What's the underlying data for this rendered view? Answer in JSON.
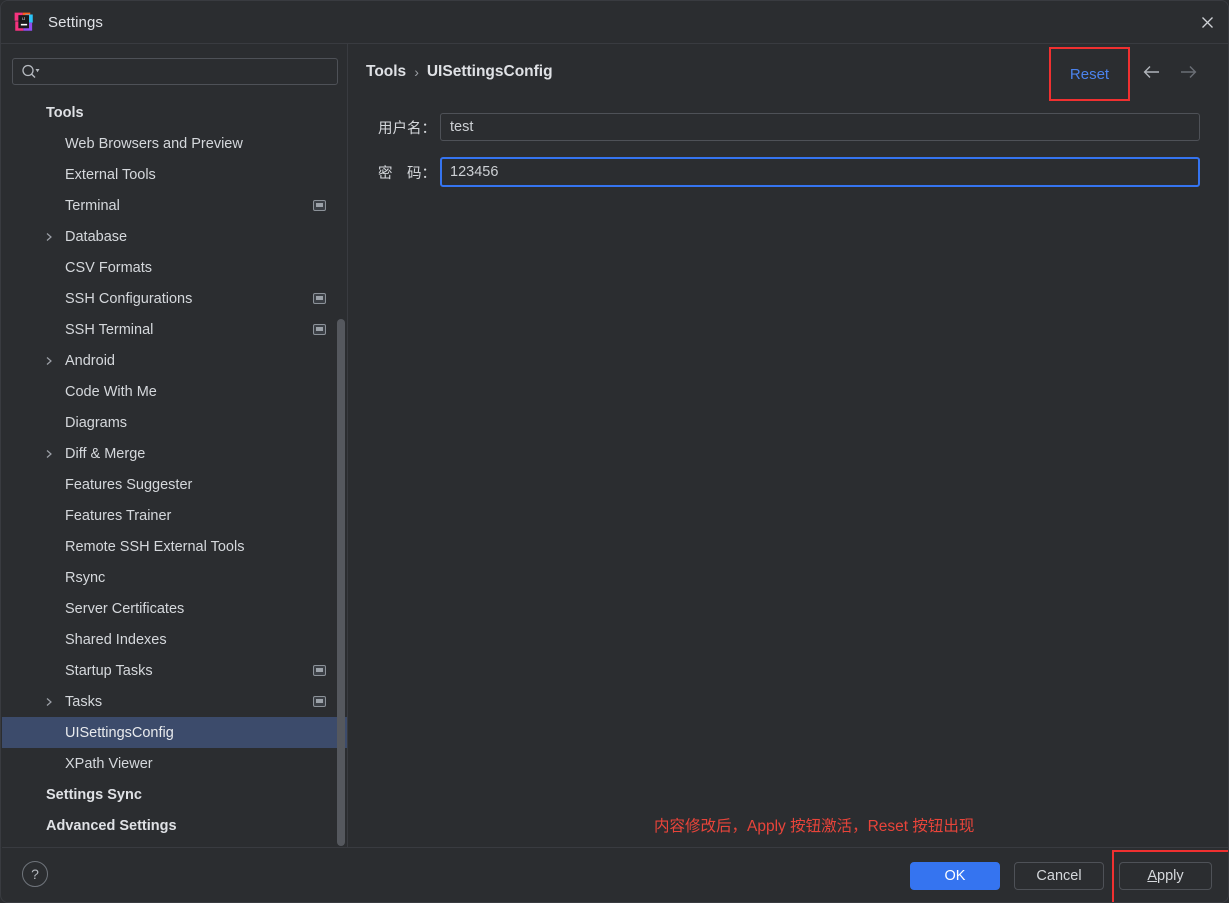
{
  "window": {
    "title": "Settings",
    "logo_icon": "intellij-idea-logo",
    "close_icon": "close-icon"
  },
  "sidebar": {
    "search": {
      "value": "",
      "placeholder": "",
      "icon": "search-icon"
    },
    "items": [
      {
        "label": "Tools",
        "level": 0,
        "arrow": false,
        "badge": false,
        "selected": false
      },
      {
        "label": "Web Browsers and Preview",
        "level": 1,
        "arrow": false,
        "badge": false,
        "selected": false
      },
      {
        "label": "External Tools",
        "level": 1,
        "arrow": false,
        "badge": false,
        "selected": false
      },
      {
        "label": "Terminal",
        "level": 1,
        "arrow": false,
        "badge": true,
        "selected": false
      },
      {
        "label": "Database",
        "level": 1,
        "arrow": true,
        "badge": false,
        "selected": false
      },
      {
        "label": "CSV Formats",
        "level": 1,
        "arrow": false,
        "badge": false,
        "selected": false
      },
      {
        "label": "SSH Configurations",
        "level": 1,
        "arrow": false,
        "badge": true,
        "selected": false
      },
      {
        "label": "SSH Terminal",
        "level": 1,
        "arrow": false,
        "badge": true,
        "selected": false
      },
      {
        "label": "Android",
        "level": 1,
        "arrow": true,
        "badge": false,
        "selected": false
      },
      {
        "label": "Code With Me",
        "level": 1,
        "arrow": false,
        "badge": false,
        "selected": false
      },
      {
        "label": "Diagrams",
        "level": 1,
        "arrow": false,
        "badge": false,
        "selected": false
      },
      {
        "label": "Diff & Merge",
        "level": 1,
        "arrow": true,
        "badge": false,
        "selected": false
      },
      {
        "label": "Features Suggester",
        "level": 1,
        "arrow": false,
        "badge": false,
        "selected": false
      },
      {
        "label": "Features Trainer",
        "level": 1,
        "arrow": false,
        "badge": false,
        "selected": false
      },
      {
        "label": "Remote SSH External Tools",
        "level": 1,
        "arrow": false,
        "badge": false,
        "selected": false
      },
      {
        "label": "Rsync",
        "level": 1,
        "arrow": false,
        "badge": false,
        "selected": false
      },
      {
        "label": "Server Certificates",
        "level": 1,
        "arrow": false,
        "badge": false,
        "selected": false
      },
      {
        "label": "Shared Indexes",
        "level": 1,
        "arrow": false,
        "badge": false,
        "selected": false
      },
      {
        "label": "Startup Tasks",
        "level": 1,
        "arrow": false,
        "badge": true,
        "selected": false
      },
      {
        "label": "Tasks",
        "level": 1,
        "arrow": true,
        "badge": true,
        "selected": false
      },
      {
        "label": "UISettingsConfig",
        "level": 1,
        "arrow": false,
        "badge": false,
        "selected": true
      },
      {
        "label": "XPath Viewer",
        "level": 1,
        "arrow": false,
        "badge": false,
        "selected": false
      },
      {
        "label": "Settings Sync",
        "level": 0,
        "arrow": false,
        "badge": false,
        "selected": false
      },
      {
        "label": "Advanced Settings",
        "level": 0,
        "arrow": false,
        "badge": false,
        "selected": false
      }
    ]
  },
  "content": {
    "breadcrumb": {
      "root": "Tools",
      "separator": "›",
      "current": "UISettingsConfig"
    },
    "reset_label": "Reset",
    "nav_back_icon": "arrow-left-icon",
    "nav_forward_icon": "arrow-right-icon",
    "fields": [
      {
        "label": "用户名：",
        "value": "test",
        "placeholder": "",
        "focused": false
      },
      {
        "label": "密　码：",
        "value": "123456",
        "placeholder": "",
        "focused": true
      }
    ],
    "hint": "内容修改后，Apply 按钮激活，Reset 按钮出现"
  },
  "footer": {
    "help_label": "?",
    "ok_label": "OK",
    "cancel_label": "Cancel",
    "apply_mnemonic": "A",
    "apply_rest": "pply"
  },
  "colors": {
    "accent": "#3574f0",
    "link": "#4b82ec",
    "annotation_red": "#f03030",
    "hint_red": "#e8443a",
    "selection": "#3c4b6b",
    "background": "#2b2d30",
    "border": "#4e5157"
  }
}
